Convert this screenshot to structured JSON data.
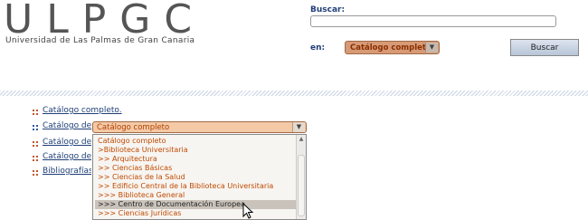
{
  "header": {
    "logo_text": "ULPGC",
    "logo_subtitle": "Universidad de Las Palmas de Gran Canaria",
    "search_label": "Buscar:",
    "search_value": "",
    "en_label": "en:",
    "catalog_select_value": "Catálogo completo",
    "search_button": "Buscar"
  },
  "nav": {
    "items": [
      {
        "label": "Catálogo completo."
      },
      {
        "label": "Catálogo de"
      },
      {
        "label": "Catálogo de r"
      },
      {
        "label": "Catálogo de r"
      },
      {
        "label": "Bibliografías r"
      }
    ],
    "select_value": "Catálogo completo"
  },
  "dropdown": {
    "options": [
      {
        "label": "Catálogo completo"
      },
      {
        "label": ">Biblioteca Universitaria"
      },
      {
        "label": ">> Arquitectura"
      },
      {
        "label": ">> Ciencias Básicas"
      },
      {
        "label": ">> Ciencias de la Salud"
      },
      {
        "label": ">> Edificio Central de la Biblioteca Universitaria"
      },
      {
        "label": ">>> Biblioteca General"
      },
      {
        "label": ">>> Centro de Documentación Europea"
      },
      {
        "label": ">>> Ciencias Jurídicas"
      }
    ],
    "selected_index": 7
  },
  "colors": {
    "link": "#1f3f77",
    "option_text": "#c04a00",
    "select_bg": "#f4c9a6",
    "bullet_orange": "#c0562a",
    "bullet_blue": "#2d5aa3"
  }
}
